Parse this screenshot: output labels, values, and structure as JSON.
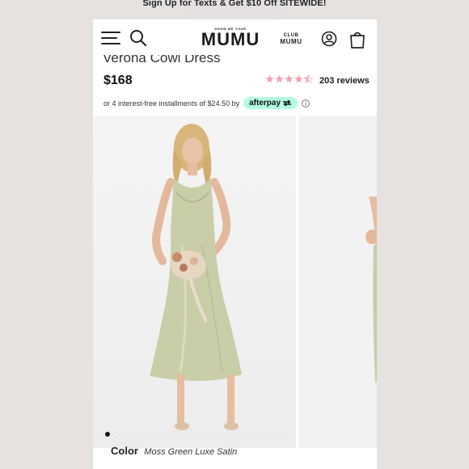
{
  "promo": {
    "text": "Sign Up for Texts & Get $10 Off SITEWIDE!"
  },
  "header": {
    "logo_small": "SHOW ME YOUR",
    "logo_main": "MUMU",
    "club_top": "CLUB",
    "club_bottom": "MUMU",
    "icons": [
      "hamburger-menu-icon",
      "search-icon",
      "account-icon",
      "shopping-bag-icon"
    ]
  },
  "product": {
    "title": "Verona Cowl Dress",
    "price": "$168",
    "rating": 4.5,
    "reviews": "203 reviews",
    "afterpay_text": "or 4 interest-free installments of $24.50 by",
    "afterpay_brand": "afterpay",
    "gallery_total": 6,
    "gallery_active": 1,
    "color_label": "Color",
    "color_value": "Moss Green Luxe Satin"
  },
  "colors": {
    "dress": "#c9cda8",
    "star": "#f3a3b2",
    "afterpay_badge": "#b2fce4"
  }
}
